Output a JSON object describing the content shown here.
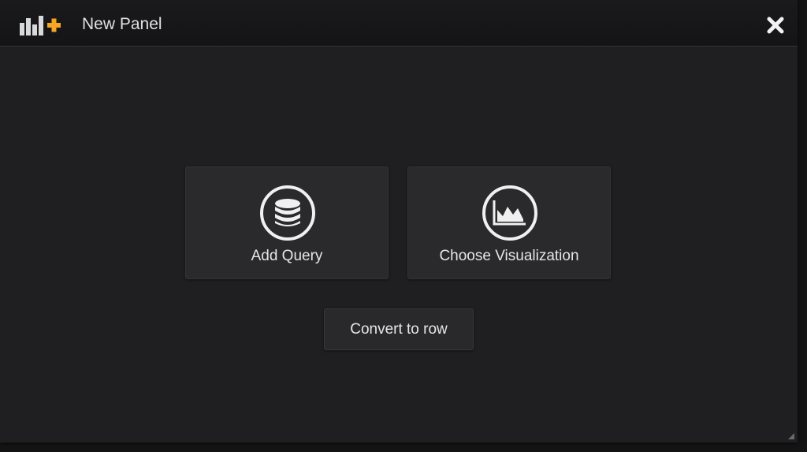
{
  "header": {
    "title": "New Panel",
    "icon": "new-panel-icon",
    "close_icon": "close-icon"
  },
  "actions": {
    "add_query": {
      "label": "Add Query",
      "icon": "database-icon"
    },
    "choose_visualization": {
      "label": "Choose Visualization",
      "icon": "visualization-icon"
    }
  },
  "convert_row": {
    "label": "Convert to row"
  },
  "colors": {
    "background": "#1f1f22",
    "header_bg": "#161618",
    "card_bg": "#2a2a2c",
    "accent": "#f5a623",
    "text": "#e6e6e6"
  }
}
